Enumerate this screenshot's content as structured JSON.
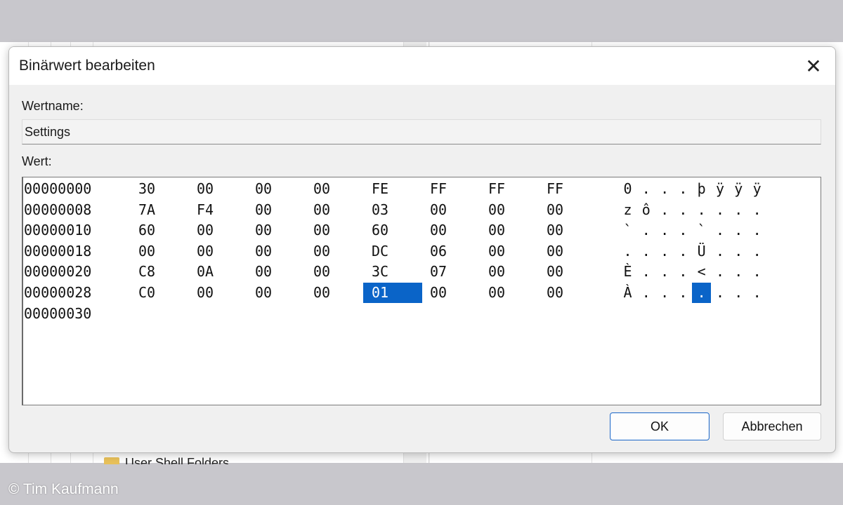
{
  "dialog": {
    "title": "Binärwert bearbeiten",
    "close_glyph": "✕",
    "value_name_label": "Wertname:",
    "value_name": "Settings",
    "value_label": "Wert:",
    "ok_label": "OK",
    "cancel_label": "Abbrechen"
  },
  "hex": {
    "rows": [
      {
        "address": "00000000",
        "bytes": [
          "30",
          "00",
          "00",
          "00",
          "FE",
          "FF",
          "FF",
          "FF"
        ],
        "ascii": [
          "0",
          ".",
          ".",
          ".",
          "þ",
          "ÿ",
          "ÿ",
          "ÿ"
        ]
      },
      {
        "address": "00000008",
        "bytes": [
          "7A",
          "F4",
          "00",
          "00",
          "03",
          "00",
          "00",
          "00"
        ],
        "ascii": [
          "z",
          "ô",
          ".",
          ".",
          ".",
          ".",
          ".",
          "."
        ]
      },
      {
        "address": "00000010",
        "bytes": [
          "60",
          "00",
          "00",
          "00",
          "60",
          "00",
          "00",
          "00"
        ],
        "ascii": [
          "`",
          ".",
          ".",
          ".",
          "`",
          ".",
          ".",
          "."
        ]
      },
      {
        "address": "00000018",
        "bytes": [
          "00",
          "00",
          "00",
          "00",
          "DC",
          "06",
          "00",
          "00"
        ],
        "ascii": [
          ".",
          ".",
          ".",
          ".",
          "Ü",
          ".",
          ".",
          "."
        ]
      },
      {
        "address": "00000020",
        "bytes": [
          "C8",
          "0A",
          "00",
          "00",
          "3C",
          "07",
          "00",
          "00"
        ],
        "ascii": [
          "È",
          ".",
          ".",
          ".",
          "<",
          ".",
          ".",
          "."
        ]
      },
      {
        "address": "00000028",
        "bytes": [
          "C0",
          "00",
          "00",
          "00",
          "01",
          "00",
          "00",
          "00"
        ],
        "ascii": [
          "À",
          ".",
          ".",
          ".",
          ".",
          ".",
          ".",
          "."
        ]
      },
      {
        "address": "00000030",
        "bytes": [],
        "ascii": []
      }
    ],
    "selected": {
      "row": 5,
      "col": 4
    }
  },
  "background": {
    "tree_folder_label": "User Shell Folders"
  },
  "credit": "© Tim Kaufmann",
  "colors": {
    "selection": "#0a64c8",
    "ok_border": "#2a6fc9"
  }
}
